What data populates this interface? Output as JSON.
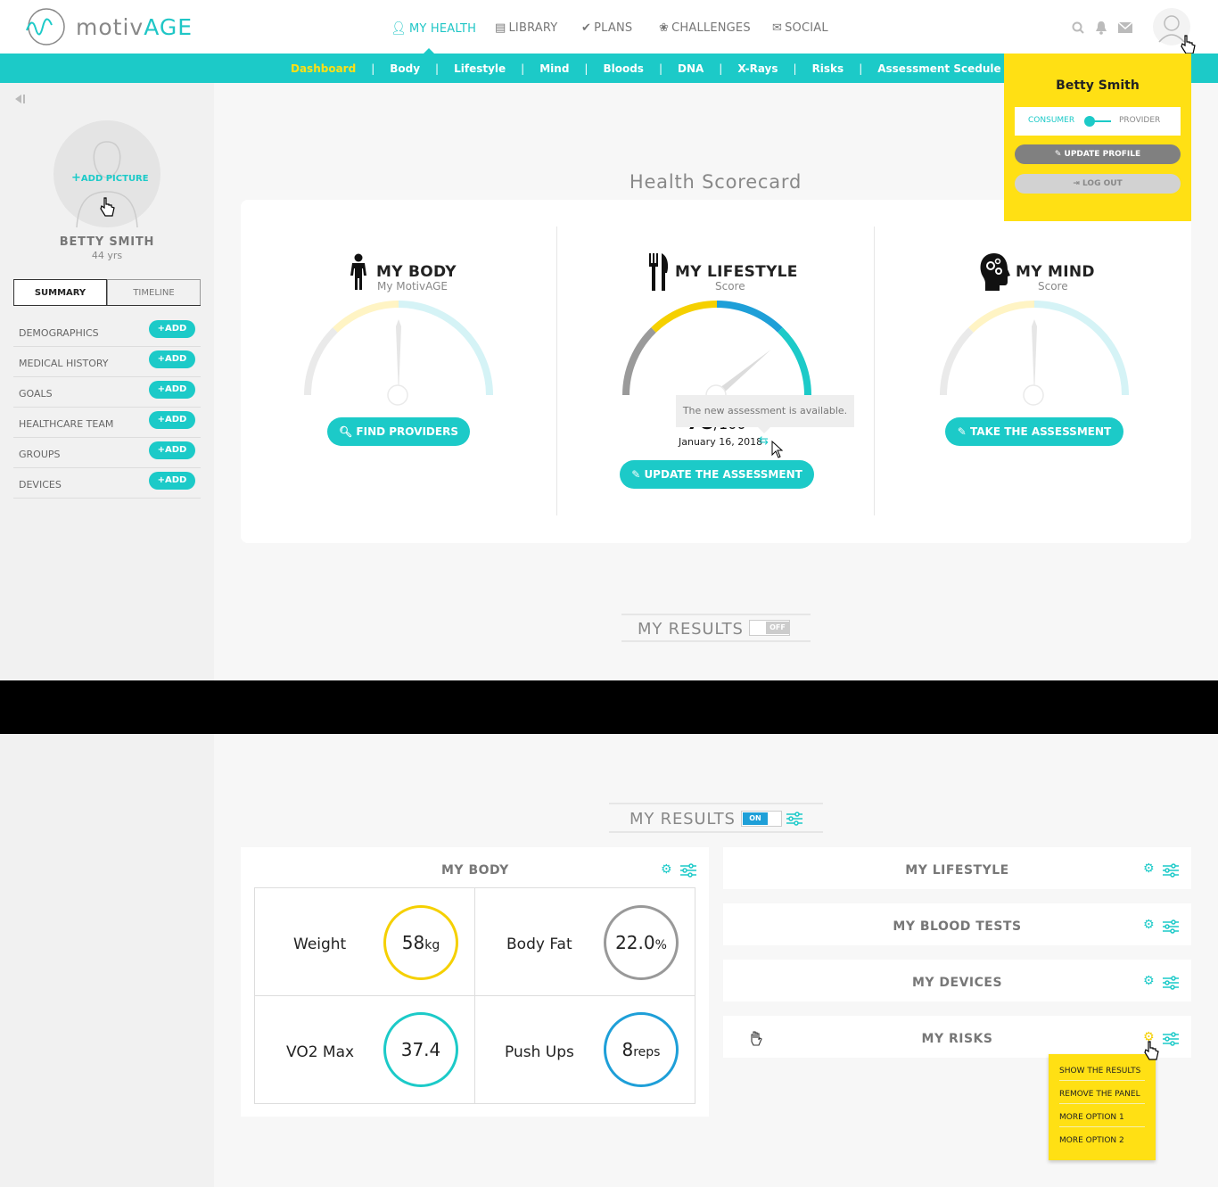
{
  "brand": {
    "name_a": "motiv",
    "name_b": "AGE",
    "accent": "#1ccac8",
    "highlight": "#ffe014"
  },
  "nav": {
    "items": [
      {
        "label": "MY HEALTH",
        "icon": "person-icon"
      },
      {
        "label": "LIBRARY",
        "icon": "document-icon"
      },
      {
        "label": "PLANS",
        "icon": "check-circle-icon"
      },
      {
        "label": "CHALLENGES",
        "icon": "award-icon"
      },
      {
        "label": "SOCIAL",
        "icon": "chat-icon"
      }
    ]
  },
  "subnav": [
    "Dashboard",
    "Body",
    "Lifestyle",
    "Mind",
    "Bloods",
    "DNA",
    "X-Rays",
    "Risks",
    "Assessment Scedule"
  ],
  "sidebar": {
    "add_picture": "ADD PICTURE",
    "name": "BETTY SMITH",
    "age": "44 yrs",
    "tabs": [
      "SUMMARY",
      "TIMELINE"
    ],
    "rows": [
      "DEMOGRAPHICS",
      "MEDICAL HISTORY",
      "GOALS",
      "HEALTHCARE TEAM",
      "GROUPS",
      "DEVICES"
    ],
    "add_label": "ADD"
  },
  "profile_menu": {
    "name": "Betty Smith",
    "consumer": "CONSUMER",
    "provider": "PROVIDER",
    "update_profile": "UPDATE PROFILE",
    "log_out": "LOG OUT"
  },
  "scorecard": {
    "title": "Health Scorecard",
    "body": {
      "title": "MY BODY",
      "subtitle": "My MotivAGE",
      "button": "FIND PROVIDERS"
    },
    "lifestyle": {
      "title": "MY LIFESTYLE",
      "subtitle": "Score",
      "score": "78",
      "score_max": "/100",
      "date": "January 16, 2018",
      "tooltip": "The new assessment is available.",
      "button": "UPDATE THE ASSESSMENT",
      "score_fraction": 0.78
    },
    "mind": {
      "title": "MY MIND",
      "subtitle": "Score",
      "button": "TAKE THE ASSESSMENT"
    }
  },
  "results_off": {
    "title": "MY RESULTS",
    "toggle": "OFF"
  },
  "results_on": {
    "title": "MY RESULTS",
    "toggle": "ON"
  },
  "body_panel": {
    "title": "MY BODY",
    "metrics": [
      {
        "label": "Weight",
        "value": "58",
        "unit": "kg",
        "color": "#f5d000"
      },
      {
        "label": "Body Fat",
        "value": "22.0",
        "unit": "%",
        "color": "#999999"
      },
      {
        "label": "VO2 Max",
        "value": "37.4",
        "unit": "",
        "color": "#1ccac8"
      },
      {
        "label": "Push Ups",
        "value": "8",
        "unit": "reps",
        "color": "#1e9fd8"
      }
    ]
  },
  "right_panels": [
    "MY LIFESTYLE",
    "MY BLOOD TESTS",
    "MY DEVICES",
    "MY RISKS"
  ],
  "context_menu": [
    "SHOW THE RESULTS",
    "REMOVE THE PANEL",
    "MORE OPTION 1",
    "MORE OPTION 2"
  ]
}
